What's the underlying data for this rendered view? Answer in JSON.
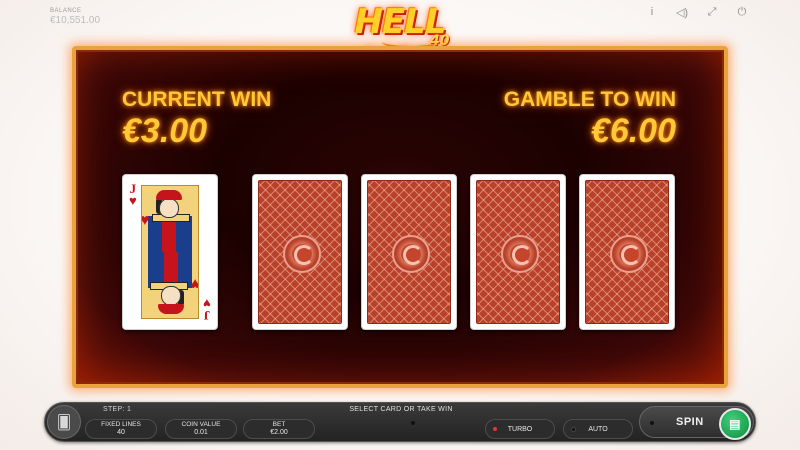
{
  "header": {
    "balance_label": "BALANCE",
    "balance_value": "€10,551.00",
    "icons": [
      "info-icon",
      "sound-icon",
      "fullscreen-icon",
      "power-icon"
    ],
    "icon_glyphs": [
      "i",
      "◁)",
      "⤢",
      "⏻"
    ]
  },
  "logo": {
    "title": "HELL HOT",
    "number": "40"
  },
  "gamble": {
    "current_win_label": "CURRENT WIN",
    "current_win_value": "€3.00",
    "gamble_to_win_label": "GAMBLE TO WIN",
    "gamble_to_win_value": "€6.00",
    "dealer_card": {
      "rank": "J",
      "suit": "♥",
      "suit_name": "hearts",
      "face_up": true
    },
    "player_cards": [
      {
        "face_up": false
      },
      {
        "face_up": false
      },
      {
        "face_up": false
      },
      {
        "face_up": false
      }
    ]
  },
  "controls": {
    "step_label": "STEP: 1",
    "message": "SELECT CARD OR TAKE WIN",
    "fixed_lines_label": "FIXED LINES",
    "fixed_lines_value": "40",
    "coin_value_label": "COIN VALUE",
    "coin_value_value": "0.01",
    "bet_label": "BET",
    "bet_value": "€2.00",
    "turbo_label": "TURBO",
    "auto_label": "AUTO",
    "spin_label": "SPIN",
    "colors": {
      "active_dot": "#e23a2a",
      "collect": "#1fa653"
    }
  }
}
